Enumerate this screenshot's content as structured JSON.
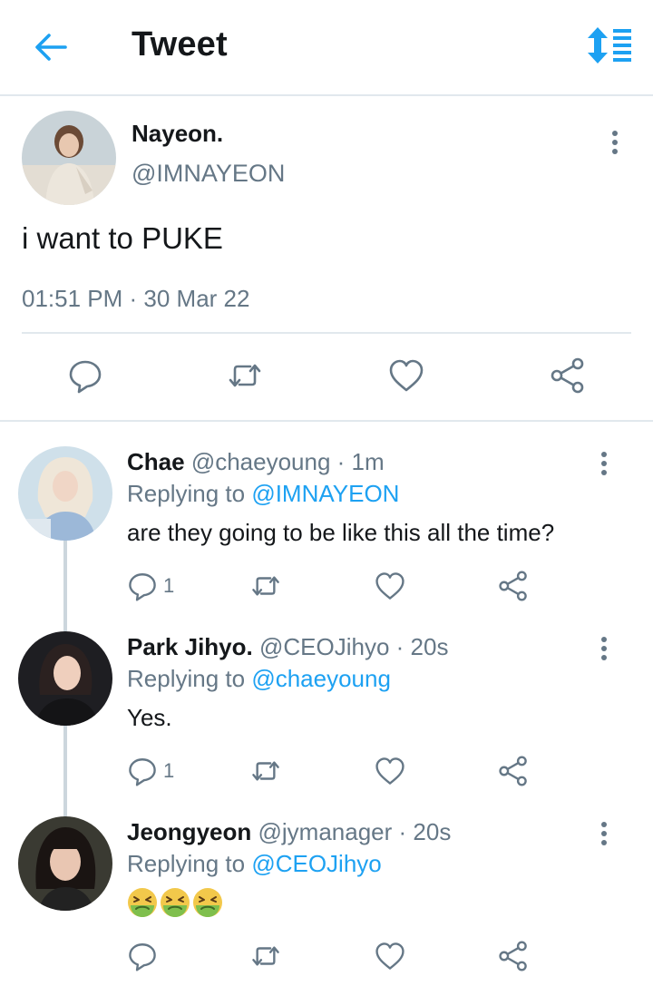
{
  "header": {
    "title": "Tweet",
    "back_icon": "arrow-left-icon",
    "sort_icon": "sort-arrows-icon",
    "accent": "#1da1f2"
  },
  "main_tweet": {
    "name": "Nayeon.",
    "handle": "@IMNAYEON",
    "text": "i want to PUKE",
    "timestamp": "01:51 PM · 30 Mar 22",
    "actions": [
      "reply-icon",
      "retweet-icon",
      "like-icon",
      "share-icon"
    ]
  },
  "replies": [
    {
      "name": "Chae",
      "handle": "@chaeyoung",
      "time": "· 1m",
      "replying_prefix": "Replying to ",
      "replying_to": "@IMNAYEON",
      "text": "are they going to be like this all the time?",
      "reply_count": "1"
    },
    {
      "name": "Park Jihyo.",
      "handle": "@CEOJihyo",
      "time": "· 20s",
      "replying_prefix": "Replying to ",
      "replying_to": "@chaeyoung",
      "text": "Yes.",
      "reply_count": "1"
    },
    {
      "name": "Jeongyeon",
      "handle": "@jymanager",
      "time": "· 20s",
      "replying_prefix": "Replying to ",
      "replying_to": "@CEOJihyo",
      "text": "",
      "emoji": [
        "nauseated-face-emoji",
        "nauseated-face-emoji",
        "nauseated-face-emoji"
      ],
      "reply_count": ""
    }
  ],
  "colors": {
    "primary_text": "#14171a",
    "secondary_text": "#657786",
    "link": "#1da1f2",
    "divider": "#e1e8ed"
  }
}
